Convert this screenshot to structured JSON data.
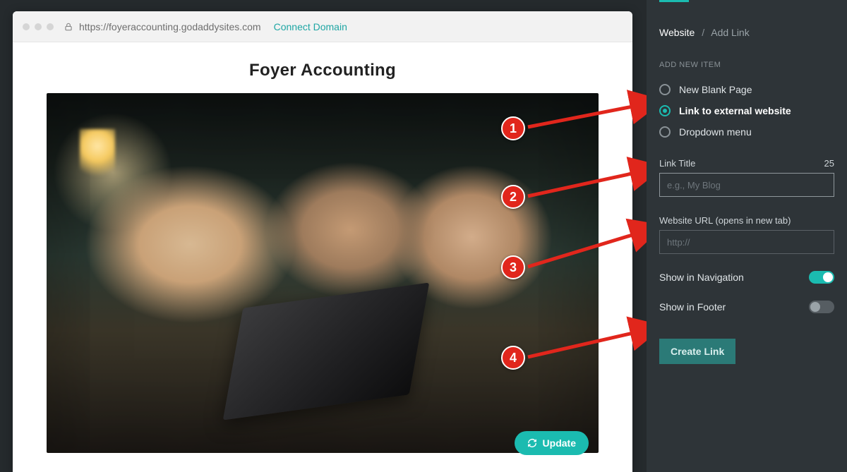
{
  "browser": {
    "url": "https://foyeraccounting.godaddysites.com",
    "connect_label": "Connect Domain"
  },
  "preview": {
    "site_title": "Foyer Accounting",
    "update_label": "Update"
  },
  "sidebar": {
    "breadcrumb_root": "Website",
    "breadcrumb_current": "Add Link",
    "section_label": "ADD NEW ITEM",
    "options": [
      {
        "label": "New Blank Page",
        "selected": false
      },
      {
        "label": "Link to external website",
        "selected": true
      },
      {
        "label": "Dropdown menu",
        "selected": false
      }
    ],
    "link_title_label": "Link Title",
    "link_title_count": "25",
    "link_title_placeholder": "e.g., My Blog",
    "url_label": "Website URL (opens in new tab)",
    "url_placeholder": "http://",
    "show_nav_label": "Show in Navigation",
    "show_footer_label": "Show in Footer",
    "create_label": "Create Link"
  },
  "annotations": [
    "1",
    "2",
    "3",
    "4"
  ]
}
